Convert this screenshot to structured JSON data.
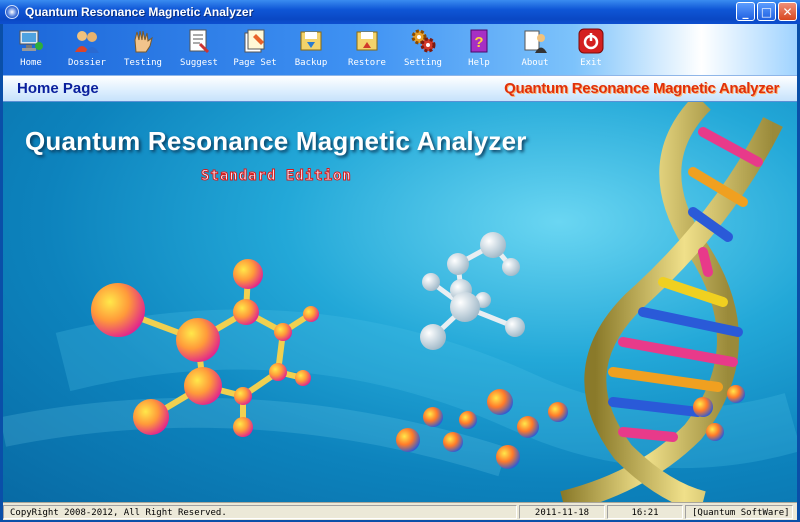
{
  "window": {
    "title": "Quantum Resonance Magnetic Analyzer"
  },
  "toolbar": {
    "items": [
      {
        "label": "Home",
        "icon": "home-icon"
      },
      {
        "label": "Dossier",
        "icon": "dossier-icon"
      },
      {
        "label": "Testing",
        "icon": "testing-icon"
      },
      {
        "label": "Suggest",
        "icon": "suggest-icon"
      },
      {
        "label": "Page Set",
        "icon": "page-set-icon"
      },
      {
        "label": "Backup",
        "icon": "backup-icon"
      },
      {
        "label": "Restore",
        "icon": "restore-icon"
      },
      {
        "label": "Setting",
        "icon": "setting-icon"
      },
      {
        "label": "Help",
        "icon": "help-icon"
      },
      {
        "label": "About",
        "icon": "about-icon"
      },
      {
        "label": "Exit",
        "icon": "exit-icon"
      }
    ]
  },
  "pagebar": {
    "title": "Home Page",
    "brand": "Quantum Resonance Magnetic Analyzer"
  },
  "main": {
    "title": "Quantum Resonance Magnetic Analyzer",
    "edition": "Standard Edition"
  },
  "status": {
    "copyright": "CopyRight 2008-2012, All Right Reserved.",
    "date": "2011-11-18",
    "time": "16:21",
    "vendor": "[Quantum SoftWare]"
  },
  "colors": {
    "title_bar": "#0a48c4",
    "brand_text": "#e0300a",
    "page_title": "#0a1f9c",
    "background": "#0d83bd"
  }
}
